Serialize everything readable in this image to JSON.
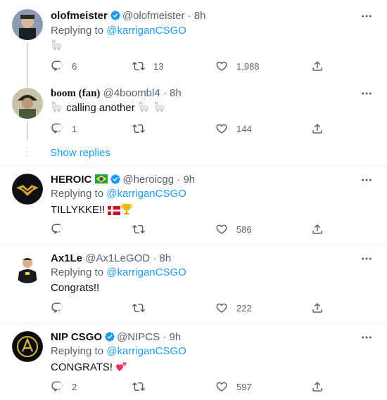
{
  "tweets": [
    {
      "name": "olofmeister",
      "handle": "@olofmeister",
      "time": "· 8h",
      "verified": true,
      "replying_label": "Replying to",
      "replying_to": "@karriganCSGO",
      "text": "",
      "emojis": [
        "goat"
      ],
      "replies": "6",
      "retweets": "13",
      "likes": "1,988"
    },
    {
      "name": "boom (fan)",
      "handle": "@4boombl4",
      "time": "· 8h",
      "verified": false,
      "text": "calling another",
      "emojis_before": [
        "goat"
      ],
      "emojis_after": [
        "goat",
        "goat"
      ],
      "replies": "1",
      "retweets": "",
      "likes": "144",
      "show_replies": "Show replies"
    },
    {
      "name": "HEROIC",
      "handle": "@heroicgg",
      "time": "· 9h",
      "verified": true,
      "flag": "brazil",
      "replying_label": "Replying to",
      "replying_to": "@karriganCSGO",
      "text": "TILLYKKE!!",
      "emojis_after": [
        "denmark-flag",
        "trophy"
      ],
      "replies": "",
      "retweets": "",
      "likes": "586"
    },
    {
      "name": "Ax1Le",
      "handle": "@Ax1LeGOD",
      "time": "· 8h",
      "verified": false,
      "replying_label": "Replying to",
      "replying_to": "@karriganCSGO",
      "text": "Congrats!!",
      "replies": "",
      "retweets": "",
      "likes": "222"
    },
    {
      "name": "NIP CSGO",
      "handle": "@NIPCS",
      "time": "· 9h",
      "verified": true,
      "replying_label": "Replying to",
      "replying_to": "@karriganCSGO",
      "text": "CONGRATS!",
      "emojis_after": [
        "two-hearts"
      ],
      "replies": "2",
      "retweets": "",
      "likes": "597"
    }
  ],
  "colors": {
    "accent": "#1d9bf0",
    "secondary_text": "#536471",
    "divider": "#eff3f4"
  }
}
